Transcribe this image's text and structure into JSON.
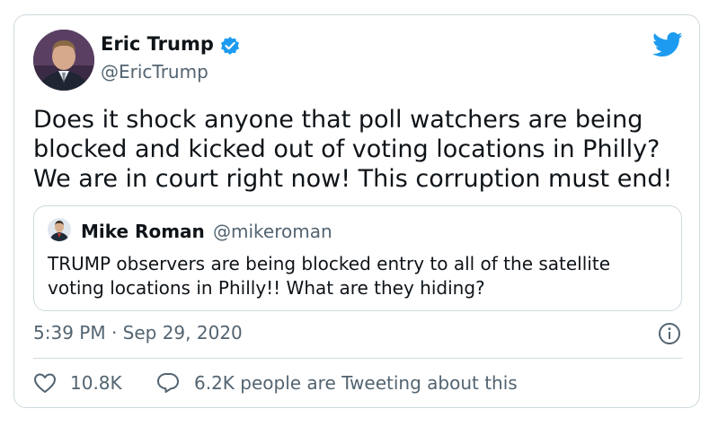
{
  "tweet": {
    "author": {
      "name": "Eric Trump",
      "handle": "@EricTrump",
      "avatar_icon": "profile-photo-icon",
      "verified_icon": "verified-badge-icon"
    },
    "brand_icon": "twitter-bird-icon",
    "text": "Does it shock anyone that poll watchers are being blocked and kicked out of voting locations in Philly? We are in court right now! This corruption must end!",
    "quoted": {
      "name": "Mike Roman",
      "handle": "@mikeroman",
      "text": "TRUMP observers are being blocked entry to all of the satellite voting locations in Philly!! What are they hiding?"
    },
    "timestamp": "5:39 PM · Sep 29, 2020",
    "info_icon": "info-icon",
    "likes": "10.8K",
    "tweeting_about": "6.2K people are Tweeting about this"
  },
  "colors": {
    "accent": "#1d9bf0",
    "secondary_text": "#536471",
    "border": "#cfd9de"
  }
}
